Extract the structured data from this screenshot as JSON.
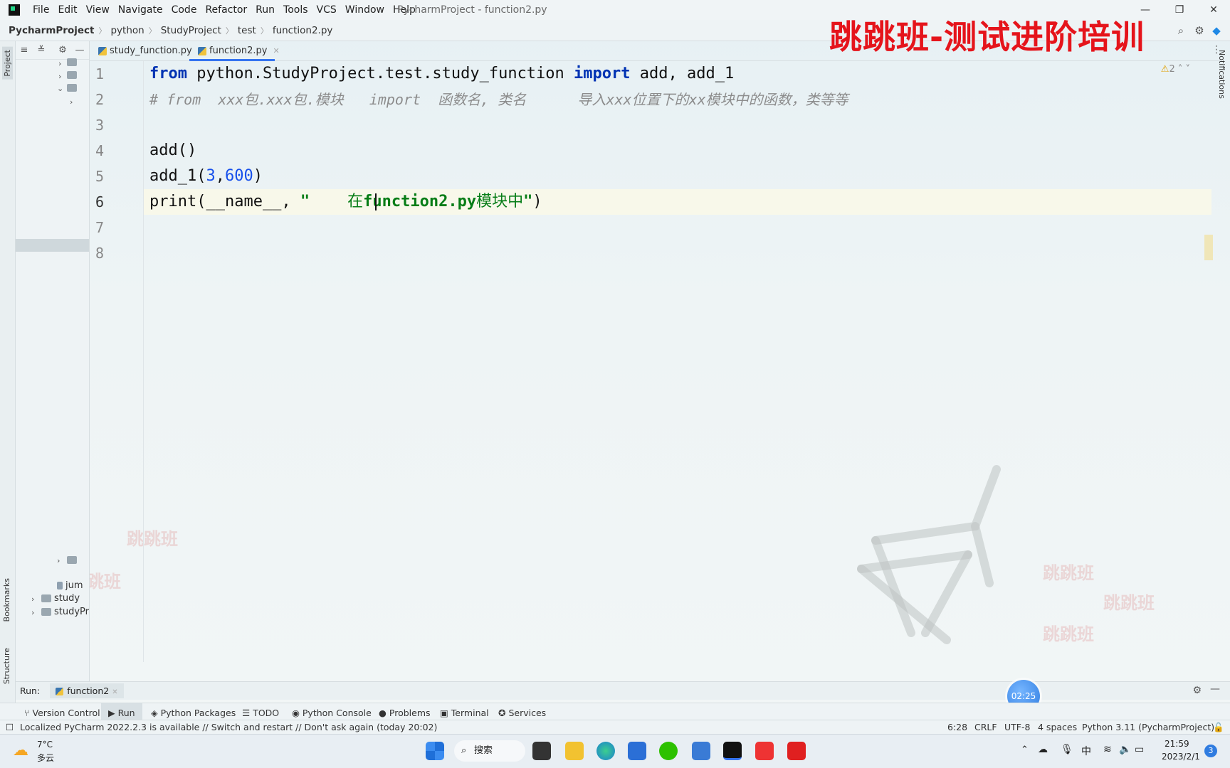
{
  "menu": [
    "File",
    "Edit",
    "View",
    "Navigate",
    "Code",
    "Refactor",
    "Run",
    "Tools",
    "VCS",
    "Window",
    "Help"
  ],
  "window_title": "PycharmProject - function2.py",
  "banner": "跳跳班-测试进阶培训",
  "breadcrumb": [
    "PycharmProject",
    "python",
    "StudyProject",
    "test",
    "function2.py"
  ],
  "left_tabs": {
    "project": "Project",
    "bookmarks": "Bookmarks",
    "structure": "Structure"
  },
  "right_tab": "Notifications",
  "tree": {
    "bottom_items": [
      {
        "label": "jum"
      },
      {
        "label": "study"
      },
      {
        "label": "studyPr"
      }
    ]
  },
  "tabs": [
    {
      "label": "study_function.py",
      "active": false
    },
    {
      "label": "function2.py",
      "active": true
    }
  ],
  "inspection_count": "2",
  "line_numbers": [
    "1",
    "2",
    "3",
    "4",
    "5",
    "6",
    "7",
    "8"
  ],
  "code": {
    "l1": {
      "kw1": "from",
      "mod": " python.StudyProject.test.study_function ",
      "kw2": "import",
      "rest": " add, add_1"
    },
    "l2": "# from  xxx包.xxx包.模块   import  函数名, 类名      导入xxx位置下的xx模块中的函数，类等等",
    "l4": "add()",
    "l5": {
      "a": "add_1(",
      "n1": "3",
      ",": ",",
      "n2": "600",
      "close": ")"
    },
    "l6": {
      "a": "print(__name__, ",
      "q": "\"",
      "s1": "    在",
      "s2": "function2.py",
      "s3": "模块中",
      "q2": "\"",
      "close": ")"
    }
  },
  "run_bar": {
    "label": "Run:",
    "config": "function2"
  },
  "tool_windows": [
    "Version Control",
    "Run",
    "Python Packages",
    "TODO",
    "Python Console",
    "Problems",
    "Terminal",
    "Services"
  ],
  "status": {
    "message": "Localized PyCharm 2022.2.3 is available // Switch and restart // Don't ask again (today 20:02)",
    "position": "6:28",
    "line_sep": "CRLF",
    "encoding": "UTF-8",
    "indent": "4 spaces",
    "interpreter": "Python 3.11 (PycharmProject)"
  },
  "timer": "02:25",
  "watermark": "跳跳班",
  "taskbar": {
    "weather_temp": "7°C",
    "weather_desc": "多云",
    "search": "搜索",
    "time": "21:59",
    "date": "2023/2/1",
    "ime": "中",
    "notif_count": "3"
  }
}
